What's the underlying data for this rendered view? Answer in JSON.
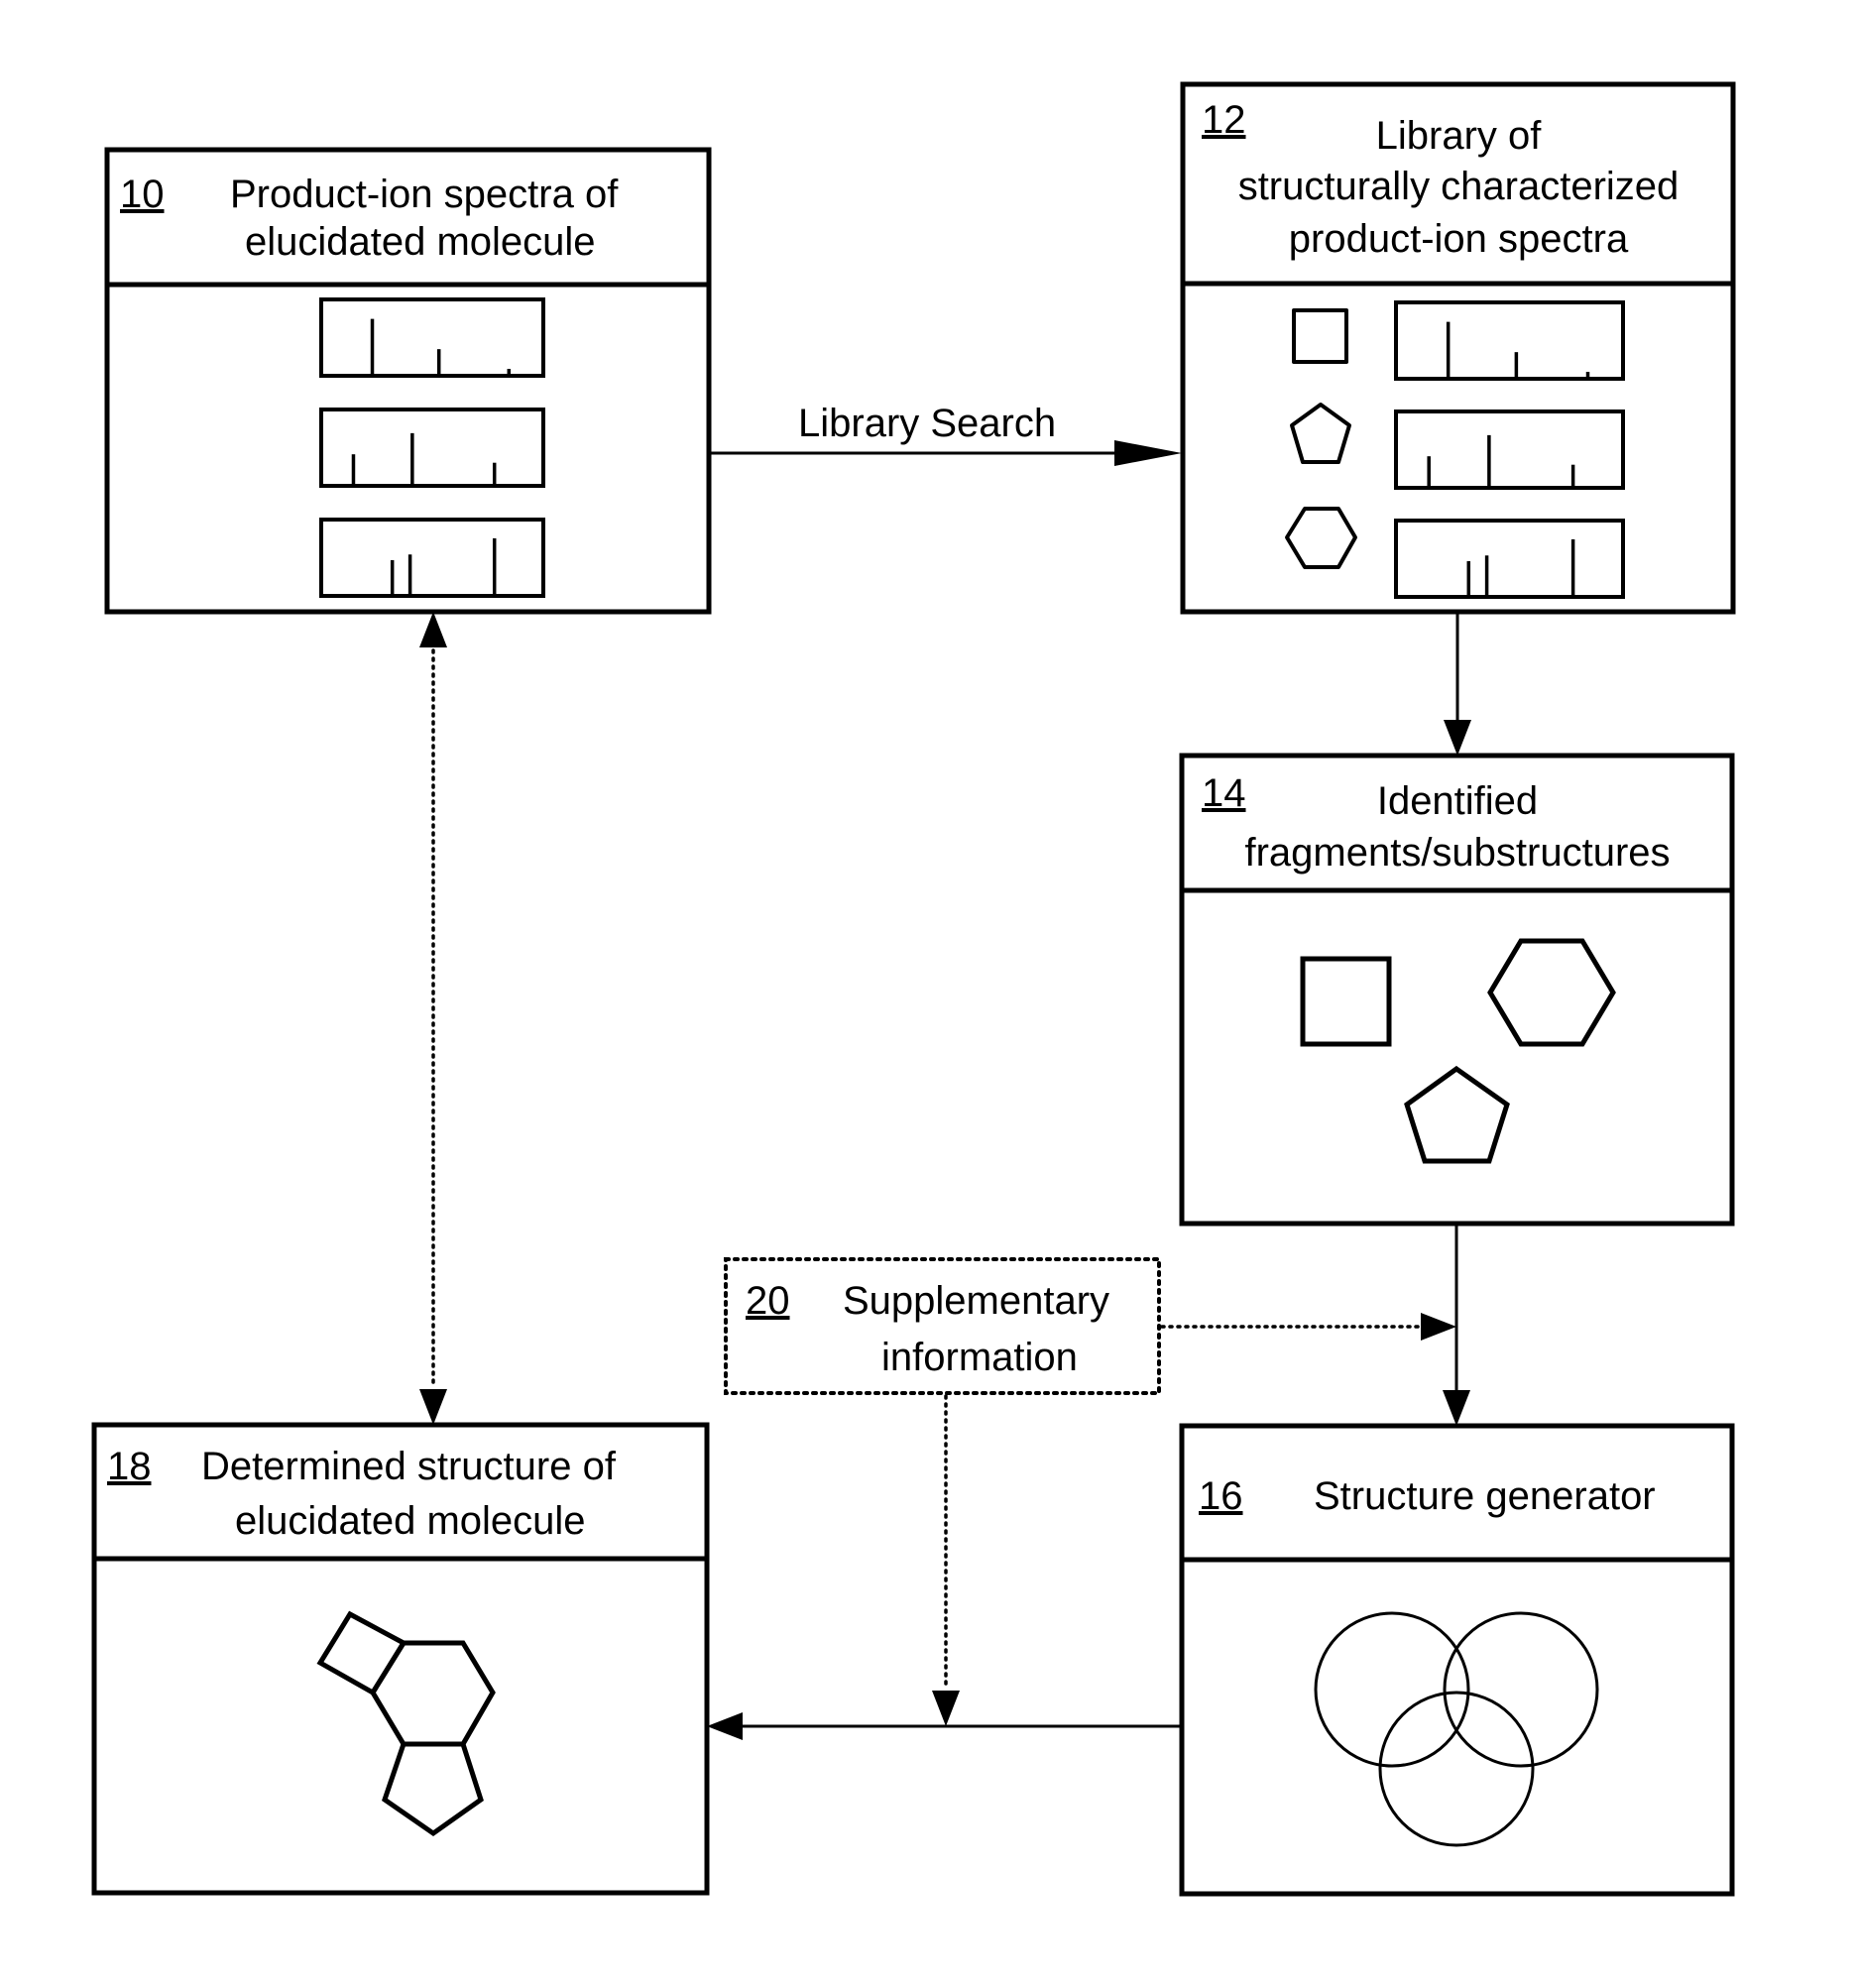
{
  "figure": {
    "boxes": {
      "b10": {
        "ref": "10",
        "lines": [
          "Product-ion spectra of",
          "elucidated molecule"
        ]
      },
      "b12": {
        "ref": "12",
        "lines": [
          "Library of",
          "structurally characterized",
          "product-ion spectra"
        ]
      },
      "b14": {
        "ref": "14",
        "lines": [
          "Identified",
          "fragments/substructures"
        ]
      },
      "b16": {
        "ref": "16",
        "lines": [
          "Structure generator"
        ]
      },
      "b18": {
        "ref": "18",
        "lines": [
          "Determined structure of",
          "elucidated molecule"
        ]
      },
      "b20": {
        "ref": "20",
        "lines": [
          "Supplementary",
          "information"
        ]
      }
    },
    "edge_labels": {
      "library_search": "Library Search"
    },
    "spectra": [
      {
        "peaks": [
          {
            "mz": 0.23,
            "intensity": 0.78
          },
          {
            "mz": 0.53,
            "intensity": 0.35
          },
          {
            "mz": 0.845,
            "intensity": 0.07
          }
        ]
      },
      {
        "peaks": [
          {
            "mz": 0.145,
            "intensity": 0.42
          },
          {
            "mz": 0.41,
            "intensity": 0.72
          },
          {
            "mz": 0.78,
            "intensity": 0.3
          }
        ]
      },
      {
        "peaks": [
          {
            "mz": 0.32,
            "intensity": 0.48
          },
          {
            "mz": 0.4,
            "intensity": 0.56
          },
          {
            "mz": 0.78,
            "intensity": 0.79
          }
        ]
      }
    ],
    "library_entries": [
      {
        "fragment": "square",
        "spectrum": 0
      },
      {
        "fragment": "pentagon",
        "spectrum": 1
      },
      {
        "fragment": "hexagon",
        "spectrum": 2
      }
    ],
    "identified_fragments": [
      "square",
      "hexagon",
      "pentagon"
    ],
    "edges": [
      {
        "from": "10",
        "to": "12",
        "style": "solid",
        "label": "Library Search"
      },
      {
        "from": "12",
        "to": "14",
        "style": "solid"
      },
      {
        "from": "14",
        "to": "16",
        "style": "solid"
      },
      {
        "from": "20",
        "to": "14-16 edge",
        "style": "dotted"
      },
      {
        "from": "16",
        "to": "18",
        "style": "solid"
      },
      {
        "from": "20",
        "to": "16-18 edge",
        "style": "dotted"
      },
      {
        "from": "18",
        "to": "10",
        "style": "dotted",
        "bidirectional": true
      }
    ],
    "colors": {
      "ink": "#000000",
      "paper": "#ffffff"
    }
  }
}
